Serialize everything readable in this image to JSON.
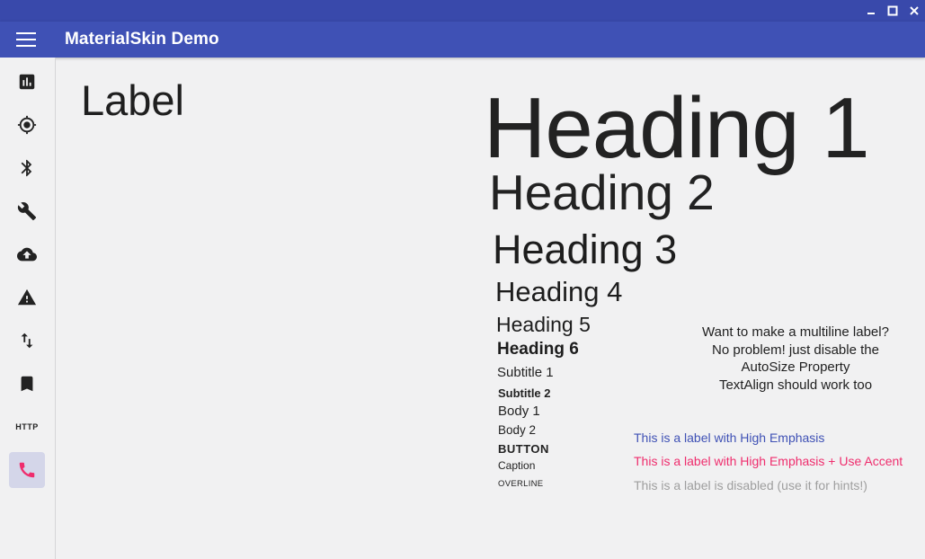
{
  "window": {
    "minimize_glyph": "–",
    "maximize_glyph": "□",
    "close_glyph": "✕"
  },
  "appbar": {
    "title": "MaterialSkin Demo",
    "color": "#3f51b5",
    "titlebar_color": "#3949ab"
  },
  "sidebar": {
    "items": [
      {
        "icon": "bar-chart-icon",
        "active": false
      },
      {
        "icon": "gps-target-icon",
        "active": false
      },
      {
        "icon": "bluetooth-icon",
        "active": false
      },
      {
        "icon": "wrench-icon",
        "active": false
      },
      {
        "icon": "cloud-upload-icon",
        "active": false
      },
      {
        "icon": "warning-icon",
        "active": false
      },
      {
        "icon": "swap-vertical-icon",
        "active": false
      },
      {
        "icon": "bookmark-icon",
        "active": false
      },
      {
        "icon": "http-icon",
        "label": "HTTP",
        "active": false
      },
      {
        "icon": "phone-icon",
        "active": true
      }
    ],
    "active_color": "#ef2d6d"
  },
  "content": {
    "label": "Label",
    "typography": {
      "heading1": "Heading 1",
      "heading2": "Heading 2",
      "heading3": "Heading 3",
      "heading4": "Heading 4",
      "heading5": "Heading 5",
      "heading6": "Heading 6",
      "subtitle1": "Subtitle 1",
      "subtitle2": "Subtitle 2",
      "body1": "Body 1",
      "body2": "Body 2",
      "button": "BUTTON",
      "caption": "Caption",
      "overline": "OVERLINE"
    },
    "multiline": [
      "Want to make a multiline label?",
      "No problem! just disable the",
      "AutoSize Property",
      "TextAlign should work too"
    ],
    "high_emphasis": "This is a label with High Emphasis",
    "high_emphasis_accent": "This is a label with High Emphasis + Use Accent",
    "disabled": "This is a label is disabled (use it for hints!)"
  },
  "colors": {
    "primary": "#3f51b5",
    "accent": "#ef2d6d",
    "disabled": "#9e9e9e",
    "background": "#f1f1f2"
  }
}
